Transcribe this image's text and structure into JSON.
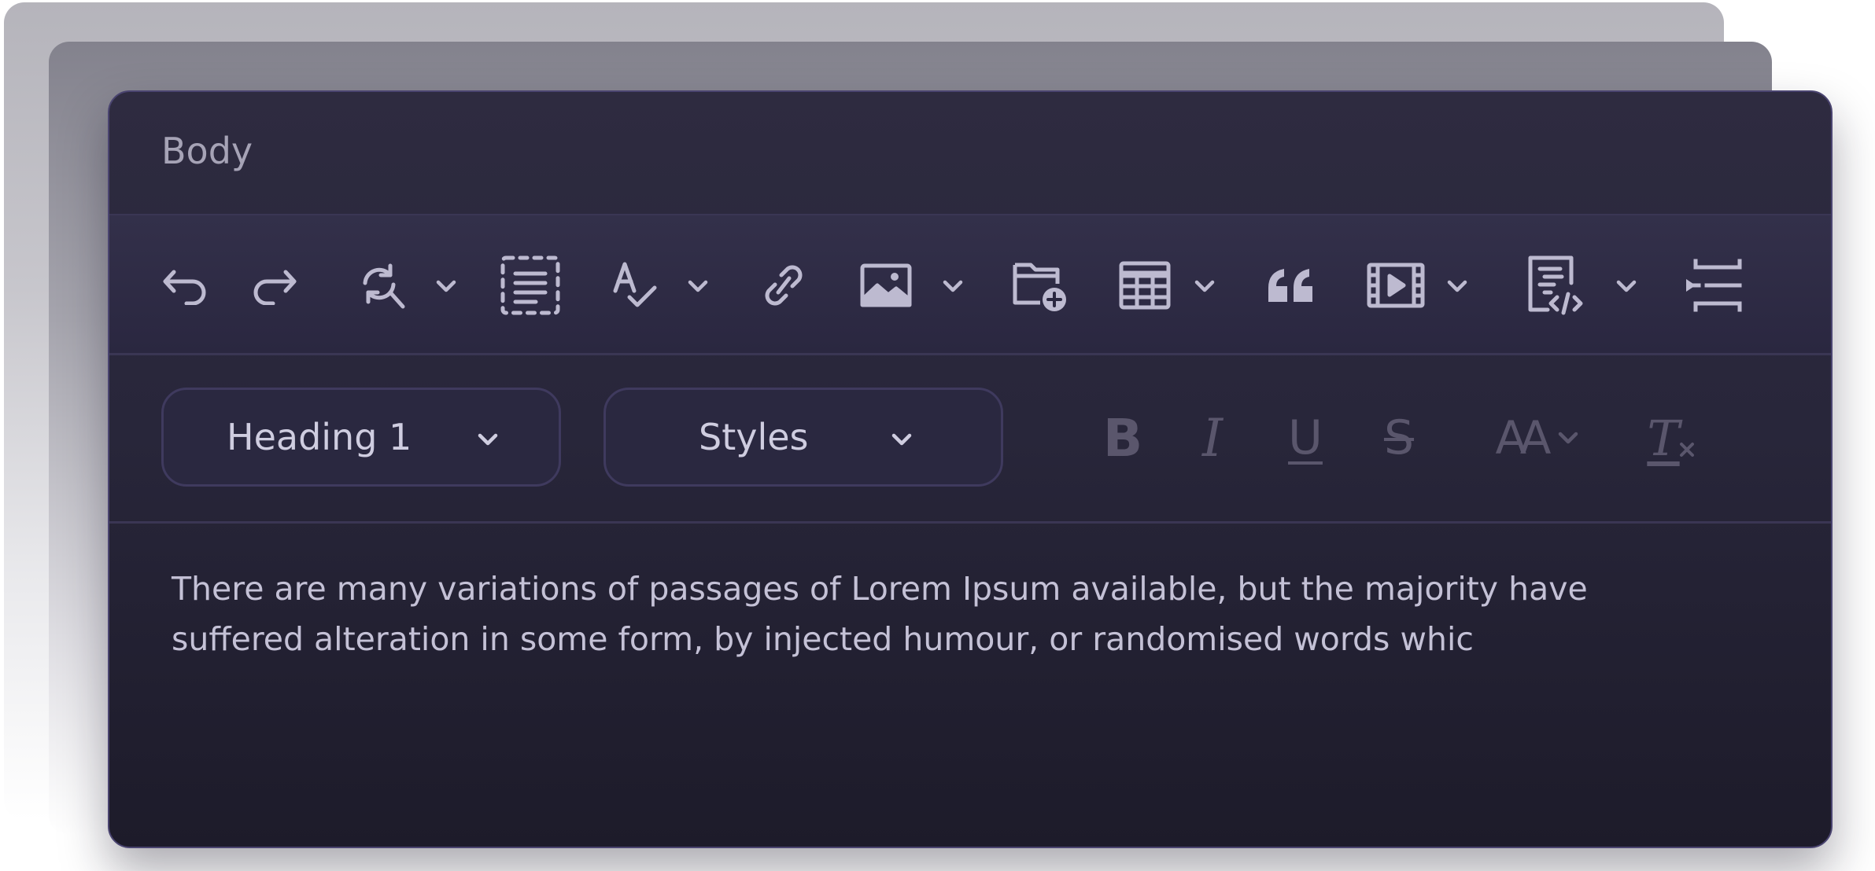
{
  "editor": {
    "title": "Body"
  },
  "toolbar": {
    "buttons": [
      {
        "name": "undo-icon",
        "has_dropdown": false
      },
      {
        "name": "redo-icon",
        "has_dropdown": false
      },
      {
        "name": "find-replace-icon",
        "has_dropdown": true
      },
      {
        "name": "select-all-icon",
        "has_dropdown": false
      },
      {
        "name": "spellcheck-icon",
        "has_dropdown": true
      },
      {
        "name": "link-icon",
        "has_dropdown": false
      },
      {
        "name": "image-icon",
        "has_dropdown": true
      },
      {
        "name": "insert-file-icon",
        "has_dropdown": false
      },
      {
        "name": "table-icon",
        "has_dropdown": true
      },
      {
        "name": "blockquote-icon",
        "has_dropdown": false
      },
      {
        "name": "media-icon",
        "has_dropdown": true
      },
      {
        "name": "source-code-icon",
        "has_dropdown": true
      },
      {
        "name": "page-break-icon",
        "has_dropdown": false
      }
    ]
  },
  "format_bar": {
    "heading_select": {
      "value": "Heading 1"
    },
    "styles_select": {
      "value": "Styles"
    },
    "buttons": {
      "bold": "B",
      "italic": "I",
      "underline": "U",
      "strikethrough": "S",
      "font_size": "AA",
      "clear_format": "T"
    }
  },
  "content": {
    "text": "There are many variations of passages of Lorem Ipsum available, but the majority have suffered alteration in some form, by injected humour, or randomised words whic"
  },
  "colors": {
    "panel_top": "#2e2b40",
    "panel_bottom": "#1d1b2a",
    "border": "#4a4470",
    "icon": "#bdbad0",
    "icon_disabled": "#5a566c",
    "text": "#c4c1d6"
  }
}
